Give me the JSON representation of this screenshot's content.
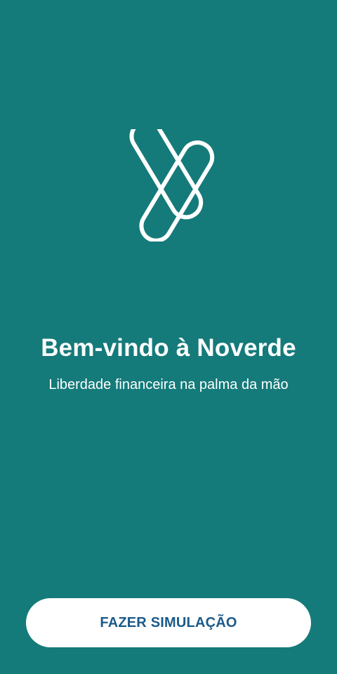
{
  "welcome": {
    "logo_icon": "noverde-v-logo-icon",
    "title": "Bem-vindo à Noverde",
    "subtitle": "Liberdade financeira na palma da mão",
    "cta_label": "FAZER SIMULAÇÃO"
  },
  "colors": {
    "background": "#157a7a",
    "button_background": "#ffffff",
    "button_text": "#1b5a8a",
    "text": "#ffffff"
  }
}
